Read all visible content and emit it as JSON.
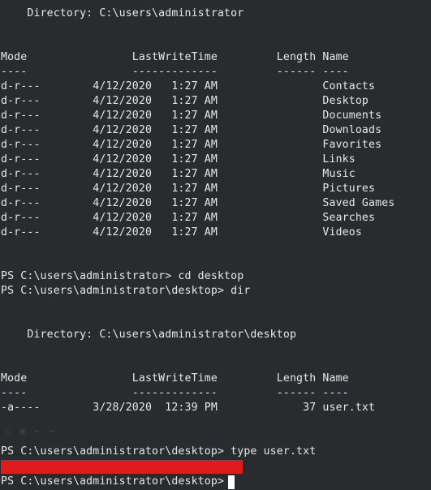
{
  "terminal": {
    "section1": {
      "directory_line": "    Directory: C:\\users\\administrator",
      "header": "Mode                LastWriteTime         Length Name",
      "underline": "----                -------------         ------ ----",
      "rows": [
        "d-r---        4/12/2020   1:27 AM                Contacts",
        "d-r---        4/12/2020   1:27 AM                Desktop",
        "d-r---        4/12/2020   1:27 AM                Documents",
        "d-r---        4/12/2020   1:27 AM                Downloads",
        "d-r---        4/12/2020   1:27 AM                Favorites",
        "d-r---        4/12/2020   1:27 AM                Links",
        "d-r---        4/12/2020   1:27 AM                Music",
        "d-r---        4/12/2020   1:27 AM                Pictures",
        "d-r---        4/12/2020   1:27 AM                Saved Games",
        "d-r---        4/12/2020   1:27 AM                Searches",
        "d-r---        4/12/2020   1:27 AM                Videos"
      ]
    },
    "commands": {
      "cd_line": "PS C:\\users\\administrator> cd desktop",
      "dir_line": "PS C:\\users\\administrator\\desktop> dir"
    },
    "section2": {
      "directory_line": "    Directory: C:\\users\\administrator\\desktop",
      "header": "Mode                LastWriteTime         Length Name",
      "underline": "----                -------------         ------ ----",
      "rows": [
        "-a----        3/28/2020  12:39 PM             37 user.txt"
      ]
    },
    "type_line": "PS C:\\users\\administrator\\desktop> type user.txt",
    "final_prompt": "PS C:\\users\\administrator\\desktop> "
  },
  "colors": {
    "background": "#2a2b2e",
    "text": "#e8e8e8",
    "redaction": "#e01b1b",
    "cursor": "#ffffff"
  }
}
